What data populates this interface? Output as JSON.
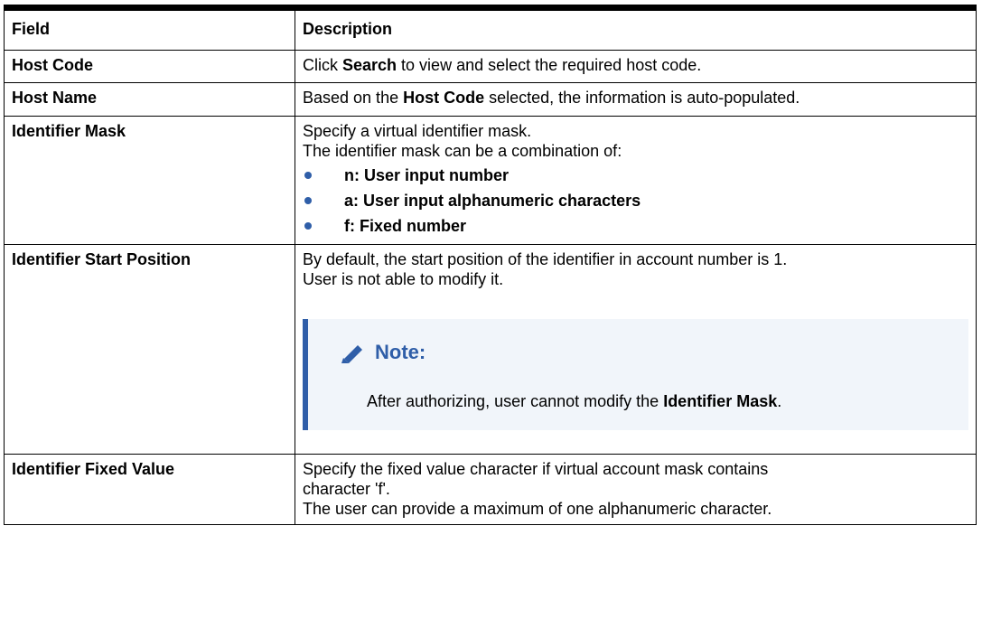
{
  "table": {
    "headers": [
      "Field",
      "Description"
    ],
    "rows": [
      {
        "field": "Host Code",
        "desc": {
          "pre": "Click ",
          "bold": "Search",
          "post": " to view and select the required host code."
        }
      },
      {
        "field": "Host Name",
        "desc": {
          "pre": "Based on the ",
          "bold": "Host Code",
          "post": " selected, the information is auto-populated."
        }
      },
      {
        "field": "Identifier Mask",
        "lines": [
          "Specify a virtual identifier mask.",
          "The identifier mask can be a combination of:"
        ],
        "bullets": [
          "n: User input number",
          "a: User input alphanumeric characters",
          "f: Fixed number"
        ]
      },
      {
        "field": "Identifier Start Position",
        "lines": [
          "By default, the start position of the identifier in account number is 1.",
          "User is not able to modify it."
        ],
        "note": {
          "icon": "pencil-icon",
          "title": "Note:",
          "pre": "After authorizing, user cannot modify the ",
          "bold": "Identifier Mask",
          "post": "."
        }
      },
      {
        "field": "Identifier Fixed Value",
        "lines": [
          "Specify the fixed value character if virtual account mask contains",
          "character 'f'.",
          "The user can provide a maximum of one alphanumeric character."
        ]
      }
    ]
  },
  "colors": {
    "accent": "#2f5ea8",
    "note_background": "#f1f5fa",
    "border": "#000000"
  }
}
